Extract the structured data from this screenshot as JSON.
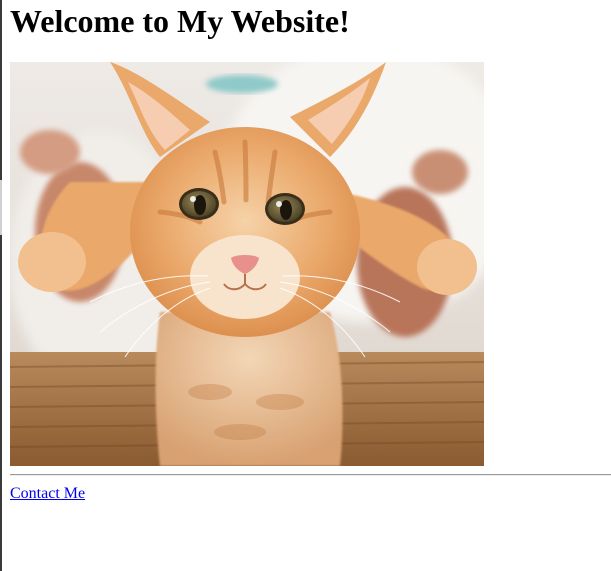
{
  "page": {
    "heading": "Welcome to My Website!",
    "contact_link": "Contact Me"
  },
  "photo": {
    "subject": "orange tabby kitten held up by hands",
    "alt": "kitten photo"
  },
  "colors": {
    "link": "#0000ee",
    "text": "#000000",
    "background": "#ffffff",
    "kitten_fur": "#e8a463",
    "backdrop": "#ece8e3",
    "basket": "#a0693a"
  }
}
